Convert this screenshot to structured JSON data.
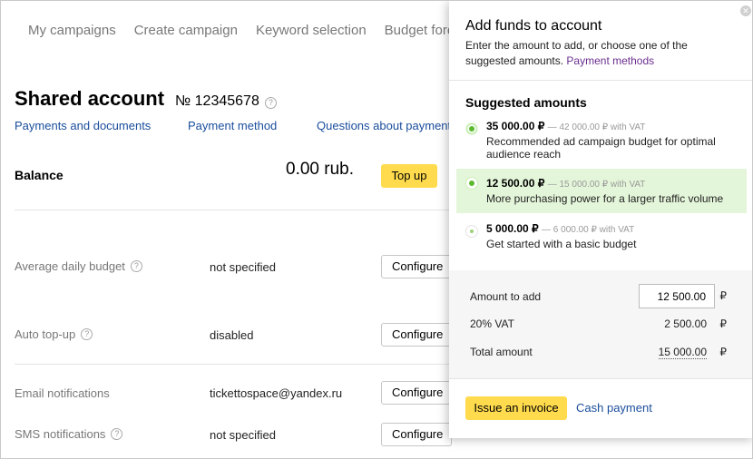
{
  "nav": [
    "My campaigns",
    "Create campaign",
    "Keyword selection",
    "Budget foreca"
  ],
  "account": {
    "title": "Shared account",
    "number": "№ 12345678",
    "help_glyph": "?",
    "links": [
      "Payments and documents",
      "Payment method",
      "Questions about payment"
    ],
    "balance_label": "Balance",
    "balance_value": "0.00 rub.",
    "topup_label": "Top up",
    "rows": [
      {
        "label": "Average daily budget",
        "value": "not specified",
        "button": "Configure",
        "help": true
      },
      {
        "label": "Auto top-up",
        "value": "disabled",
        "button": "Configure",
        "help": true
      },
      {
        "label": "Email notifications",
        "value": "tickettospace@yandex.ru",
        "button": "Configure",
        "help": false
      },
      {
        "label": "SMS notifications",
        "value": "not specified",
        "button": "Configure",
        "help": true
      }
    ]
  },
  "popup": {
    "title": "Add funds to account",
    "description": "Enter the amount to add, or choose one of the suggested amounts.",
    "payment_methods_link": "Payment methods",
    "suggested_title": "Suggested amounts",
    "suggestions": [
      {
        "amount": "35 000.00 ₽",
        "vat": "— 42 000.00 ₽ with VAT",
        "description": "Recommended ad campaign budget for optimal audience reach",
        "selected": false
      },
      {
        "amount": "12 500.00 ₽",
        "vat": "— 15 000.00 ₽ with VAT",
        "description": "More purchasing power for a larger traffic volume",
        "selected": true
      },
      {
        "amount": "5 000.00 ₽",
        "vat": "— 6 000.00 ₽ with VAT",
        "description": "Get started with a basic budget",
        "selected": false
      }
    ],
    "amount_label": "Amount to add",
    "amount_value": "12 500.00",
    "vat_label": "20% VAT",
    "vat_value": "2 500.00",
    "total_label": "Total amount",
    "total_value": "15 000.00",
    "currency": "₽",
    "invoice_button": "Issue an invoice",
    "cash_link": "Cash payment",
    "close_icon": "close-icon"
  },
  "colors": {
    "accent_yellow": "#ffdb4d",
    "link_blue": "#1a4d9c",
    "selected_green": "#e4f6d9",
    "radio_green": "#5cb82f"
  }
}
